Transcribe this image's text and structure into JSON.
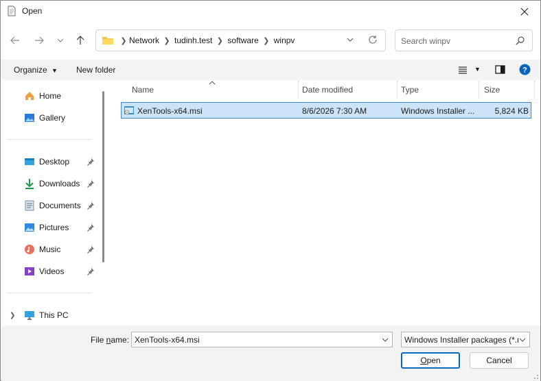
{
  "window": {
    "title": "Open"
  },
  "breadcrumb": [
    "Network",
    "tudinh.test",
    "software",
    "winpv"
  ],
  "search": {
    "placeholder": "Search winpv"
  },
  "toolbar": {
    "organize_label": "Organize",
    "new_folder_label": "New folder"
  },
  "sidebar": {
    "items": [
      {
        "label": "Home",
        "icon": "home-icon"
      },
      {
        "label": "Gallery",
        "icon": "gallery-icon"
      },
      {
        "label": "Desktop",
        "icon": "desktop-icon",
        "pinned": true
      },
      {
        "label": "Downloads",
        "icon": "downloads-icon",
        "pinned": true
      },
      {
        "label": "Documents",
        "icon": "documents-icon",
        "pinned": true
      },
      {
        "label": "Pictures",
        "icon": "pictures-icon",
        "pinned": true
      },
      {
        "label": "Music",
        "icon": "music-icon",
        "pinned": true
      },
      {
        "label": "Videos",
        "icon": "videos-icon",
        "pinned": true
      },
      {
        "label": "This PC",
        "icon": "this-pc-icon"
      }
    ]
  },
  "columns": {
    "name": "Name",
    "date": "Date modified",
    "type": "Type",
    "size": "Size"
  },
  "files": [
    {
      "name": "XenTools-x64.msi",
      "date": "8/6/2026 7:30 AM",
      "type": "Windows Installer ...",
      "size": "5,824 KB",
      "selected": true
    }
  ],
  "footer": {
    "file_name_label_pre": "File ",
    "file_name_label_accel": "n",
    "file_name_label_post": "ame:",
    "file_name_value": "XenTools-x64.msi",
    "file_type_value": "Windows Installer packages (*.msi)",
    "open_accel": "O",
    "open_rest": "pen",
    "cancel_label": "Cancel"
  },
  "colors": {
    "accent": "#0067c0",
    "selection": "#cce4f7",
    "selection_border": "#3f87c9"
  }
}
